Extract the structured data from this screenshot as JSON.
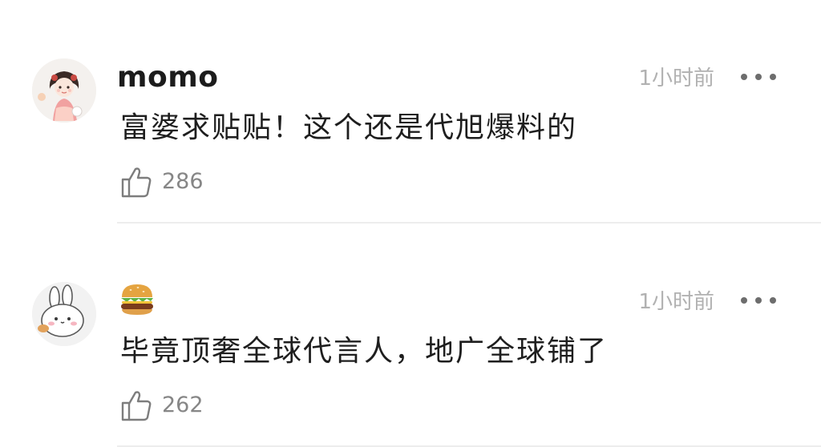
{
  "comments": [
    {
      "username": "momo",
      "time": "1小时前",
      "text": "富婆求贴贴！这个还是代旭爆料的",
      "likes": "286",
      "avatar_icon": "girl-illustration-avatar",
      "name_icon": null
    },
    {
      "username": "",
      "time": "1小时前",
      "text": "毕竟顶奢全球代言人，地广全球铺了",
      "likes": "262",
      "avatar_icon": "bunny-cartoon-avatar",
      "name_icon": "hamburger-emoji"
    }
  ],
  "colors": {
    "background": "#ffffff",
    "muted_text": "#b1b1b1",
    "count_text": "#868686",
    "divider": "#ededed"
  }
}
